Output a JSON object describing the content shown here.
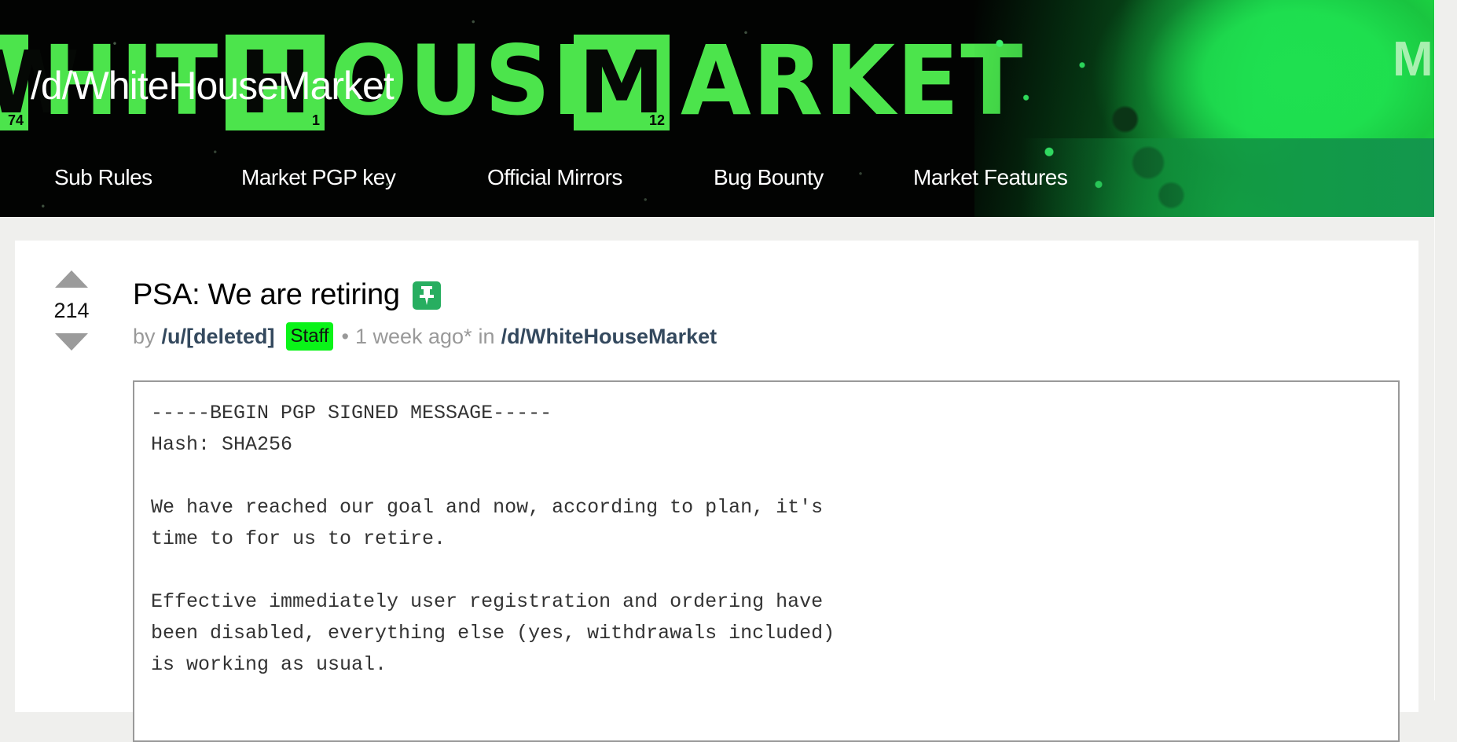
{
  "banner": {
    "subreddit_title": "/d/WhiteHouseMarket",
    "logo": {
      "box_letters": [
        {
          "letter": "W",
          "number": "74"
        },
        {
          "letter": "H",
          "number": "1"
        },
        {
          "letter": "M",
          "number": "12"
        }
      ],
      "words": [
        "HITE",
        "OUSE",
        "ARKET"
      ],
      "side_letter": "M"
    },
    "nav": [
      {
        "label": "Sub Rules"
      },
      {
        "label": "Market PGP key"
      },
      {
        "label": "Official Mirrors"
      },
      {
        "label": "Bug Bounty"
      },
      {
        "label": "Market Features"
      }
    ]
  },
  "post": {
    "score": "214",
    "title": "PSA: We are retiring",
    "pinned_icon": "pin-icon",
    "meta": {
      "by": "by",
      "author": "/u/[deleted]",
      "badge": "Staff",
      "bullet": "•",
      "time": "1 week ago*",
      "in": "in",
      "forum": "/d/WhiteHouseMarket"
    },
    "body_lines": [
      "-----BEGIN PGP SIGNED MESSAGE-----",
      "Hash: SHA256",
      "",
      "We have reached our goal and now, according to plan, it's",
      "time to for us to retire.",
      "",
      "Effective immediately user registration and ordering have",
      "been disabled, everything else (yes, withdrawals included)",
      "is working as usual."
    ]
  },
  "colors": {
    "brand_green": "#4ce44c",
    "pin_green": "#27ae60",
    "staff_green": "#0af318",
    "link_dark": "#34495e",
    "page_bg": "#efefed"
  }
}
